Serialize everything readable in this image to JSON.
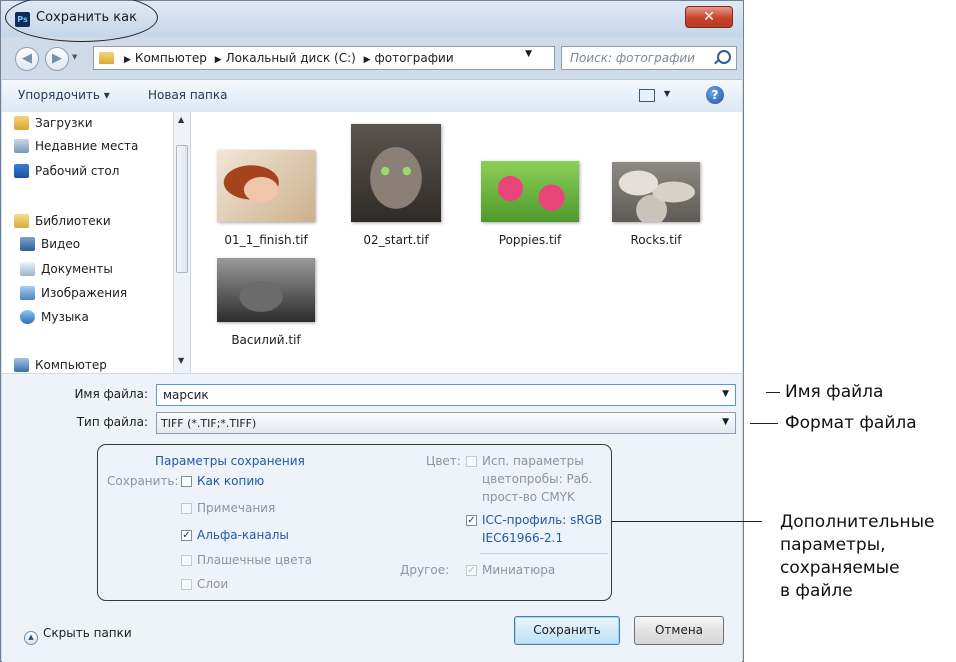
{
  "window": {
    "title": "Сохранить как",
    "ps_icon": "Ps",
    "close_icon": "close-icon"
  },
  "address": {
    "crumbs": [
      "Компьютер",
      "Локальный диск (C:)",
      "фотографии"
    ],
    "search_placeholder": "Поиск: фотографии"
  },
  "toolbar": {
    "organize": "Упорядочить ▾",
    "new_folder": "Новая папка"
  },
  "nav": {
    "items": [
      {
        "label": "Загрузки",
        "icon": "downloads-icon"
      },
      {
        "label": "Недавние места",
        "icon": "recent-places-icon"
      },
      {
        "label": "Рабочий стол",
        "icon": "desktop-icon"
      },
      {
        "label": "Библиотеки",
        "icon": "libraries-icon"
      },
      {
        "label": "Видео",
        "icon": "video-icon"
      },
      {
        "label": "Документы",
        "icon": "documents-icon"
      },
      {
        "label": "Изображения",
        "icon": "pictures-icon"
      },
      {
        "label": "Музыка",
        "icon": "music-icon"
      },
      {
        "label": "Компьютер",
        "icon": "computer-icon"
      }
    ]
  },
  "files": [
    {
      "name": "01_1_finish.tif"
    },
    {
      "name": "02_start.tif"
    },
    {
      "name": "Poppies.tif"
    },
    {
      "name": "Rocks.tif"
    },
    {
      "name": "Василий.tif"
    }
  ],
  "form": {
    "filename_label": "Имя файла:",
    "filename_value": "марсик",
    "filetype_label": "Тип файла:",
    "filetype_value": "TIFF (*.TIF;*.TIFF)"
  },
  "options": {
    "header": "Параметры сохранения",
    "save_label": "Сохранить:",
    "as_copy": "Как копию",
    "notes": "Примечания",
    "alpha": "Альфа-каналы",
    "spot": "Плашечные цвета",
    "layers": "Слои",
    "color_label": "Цвет:",
    "proof_line1": "Исп. параметры",
    "proof_line2": "цветопробы:  Раб.",
    "proof_line3": "прост-во CMYK",
    "icc_line1": "ICC-профиль:  sRGB",
    "icc_line2": "IEC61966-2.1",
    "other_label": "Другое:",
    "thumbnail": "Миниатюра",
    "checked": {
      "as_copy": false,
      "notes": false,
      "alpha": true,
      "spot": false,
      "layers": false,
      "proof": false,
      "icc": true,
      "thumbnail": true
    }
  },
  "footer": {
    "hide_folders": "Скрыть папки",
    "save_button": "Сохранить",
    "cancel_button": "Отмена"
  },
  "annotations": {
    "filename": "Имя файла",
    "format": "Формат файла",
    "extra_1": "Дополнительные",
    "extra_2": "параметры,",
    "extra_3": "сохраняемые",
    "extra_4": "в файле"
  }
}
